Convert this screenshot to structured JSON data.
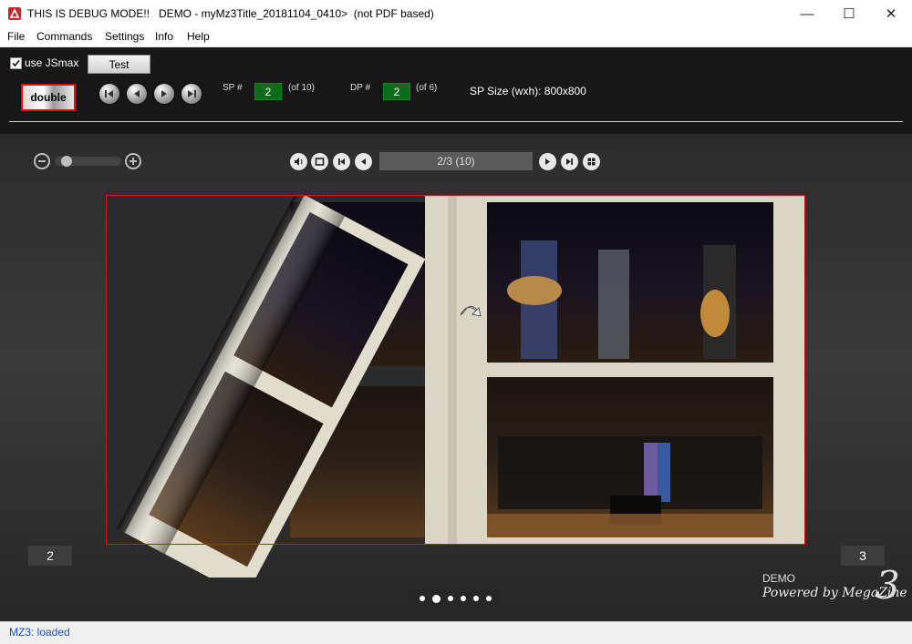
{
  "window": {
    "title": "THIS IS DEBUG MODE!!   DEMO - myMz3Title_20181104_0410>  (not PDF based)",
    "minimize_glyph": "—",
    "maximize_glyph": "☐",
    "close_glyph": "✕"
  },
  "menu": [
    "File",
    "Commands",
    "Settings",
    "Info",
    "Help"
  ],
  "toolbar": {
    "use_jsmax_label": "use JSmax",
    "use_jsmax_checked": true,
    "test_label": "Test",
    "double_label": "double",
    "sp_label": "SP #",
    "sp_value": "2",
    "sp_of": "(of 10)",
    "dp_label": "DP #",
    "dp_value": "2",
    "dp_of": "(of 6)",
    "sp_size": "SP Size (wxh): 800x800"
  },
  "viewer": {
    "page_indicator": "2/3 (10)",
    "left_page_number": "2",
    "right_page_number": "3",
    "zoom_level": 0.12,
    "pagination_dots": 6,
    "active_dot": 1
  },
  "branding": {
    "demo_label": "DEMO",
    "powered_by": "Powered by MegaZine",
    "logo_digit": "3"
  },
  "status": {
    "text": "MZ3: loaded"
  },
  "colors": {
    "accent_red": "#dd1111",
    "green_field": "#0a6b1a",
    "status_blue": "#1a4fd6"
  }
}
